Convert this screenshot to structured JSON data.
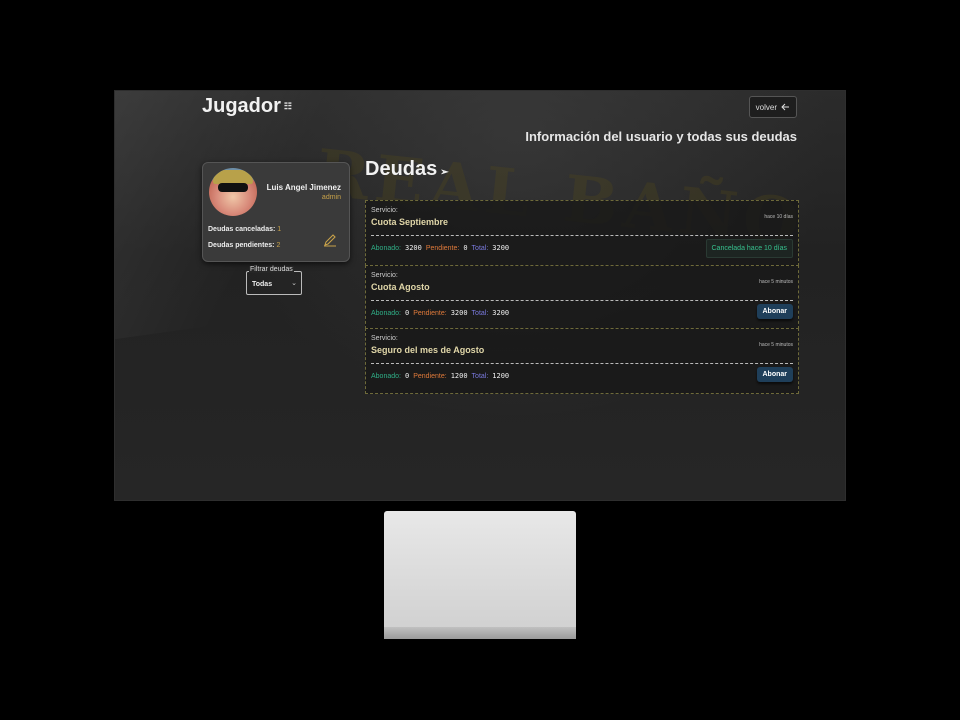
{
  "header": {
    "title": "Jugador",
    "title_icon": "user-list-icon",
    "back_label": "volver",
    "subtitle": "Información del usuario y todas sus deudas"
  },
  "watermark": "REAL BAÑO",
  "user": {
    "name": "Luis Angel Jimenez",
    "role": "admin",
    "paid_label": "Deudas canceladas:",
    "paid_count": "1",
    "pending_label": "Deudas pendientes:",
    "pending_count": "2"
  },
  "filter": {
    "legend": "Filtrar deudas",
    "value": "Todas",
    "chevron": "⌄"
  },
  "debts": {
    "title": "Deudas",
    "title_icon": "rocket-icon",
    "items": [
      {
        "service_label": "Servicio:",
        "service": "Cuota Septiembre",
        "time": "hace 10 días",
        "paid_label": "Abonado:",
        "paid": "3200",
        "pending_label": "Pendiente:",
        "pending": "0",
        "total_label": "Total:",
        "total": "3200",
        "status": "Cancelada hace 10 días"
      },
      {
        "service_label": "Servicio:",
        "service": "Cuota Agosto",
        "time": "hace 5 minutos",
        "paid_label": "Abonado:",
        "paid": "0",
        "pending_label": "Pendiente:",
        "pending": "3200",
        "total_label": "Total:",
        "total": "3200",
        "action": "Abonar"
      },
      {
        "service_label": "Servicio:",
        "service": "Seguro del mes de Agosto",
        "time": "hace 5 minutos",
        "paid_label": "Abonado:",
        "paid": "0",
        "pending_label": "Pendiente:",
        "pending": "1200",
        "total_label": "Total:",
        "total": "1200",
        "action": "Abonar"
      }
    ]
  },
  "colors": {
    "accent_gold": "#c8a24a",
    "paid_green": "#2fae86",
    "pending_orange": "#e07a3a",
    "total_purple": "#7a7adf",
    "button_blue": "#1f3f5a"
  }
}
